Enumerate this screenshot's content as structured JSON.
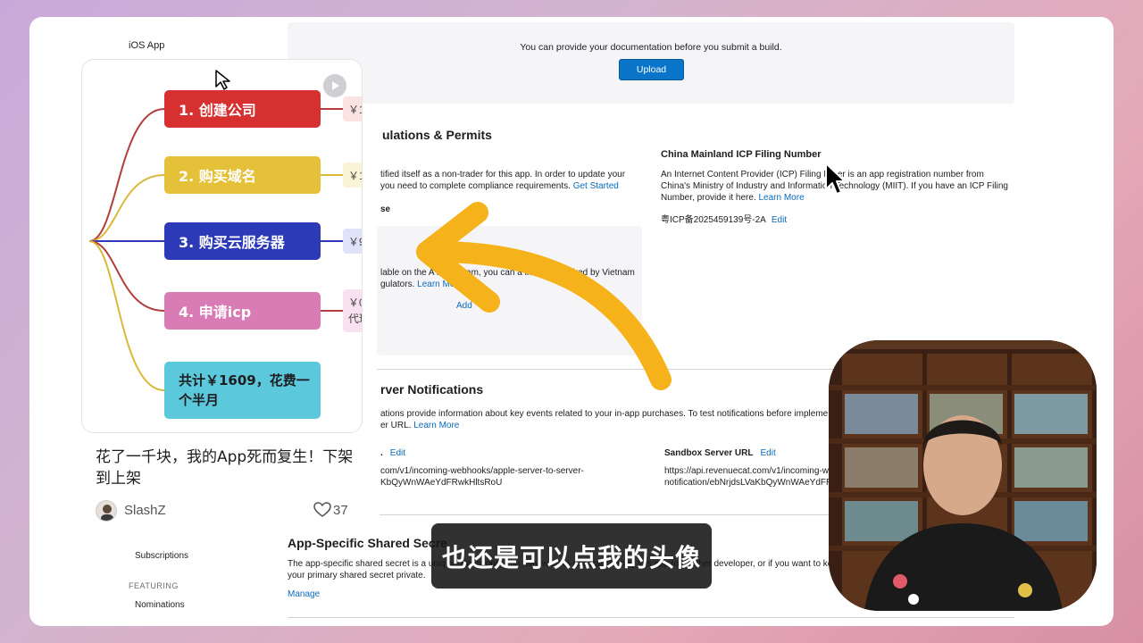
{
  "sidebar": {
    "app_label": "iOS App",
    "subscriptions": "Subscriptions",
    "featuring_header": "FEATURING",
    "nominations": "Nominations"
  },
  "documentation": {
    "text": "You can provide your documentation before you submit a build.",
    "upload_label": "Upload"
  },
  "regulations": {
    "heading": "ulations & Permits",
    "trader_text": "tified itself as a non-trader for this app. In order to update your you need to complete compliance requirements.",
    "trader_link": "Get Started",
    "section_label": "se",
    "vn_text": "lable on the A     in Vietnam, you can a         license required by Vietnam   gulators.",
    "vn_link": "Learn More",
    "vn_add": "Add"
  },
  "icp": {
    "title": "China Mainland ICP Filing Number",
    "description": "An Internet Content Provider (ICP) Filing N    ber is an app registration number from China's Ministry of Industry and Information Technology (MIIT). If you have an ICP Filing Number, provide it here.",
    "link": "Learn More",
    "value": "粤ICP备2025459139号-2A",
    "edit": "Edit"
  },
  "server_notifications": {
    "heading": "rver Notifications",
    "description": "ations provide information about key events related to your in-app purchases. To test notifications before impleme",
    "description2": "er URL.",
    "link": "Learn More",
    "production_label": ".",
    "production_edit": "Edit",
    "production_url": "com/v1/incoming-webhooks/apple-server-to-server-KbQyWnWAeYdFRwkHltsRoU",
    "sandbox_label": "Sandbox Server URL",
    "sandbox_edit": "Edit",
    "sandbox_url_1": "https://api.revenuecat.com/v1/incoming-w",
    "sandbox_url_2": "notification/ebNrjdsLVaKbQyWnWAeYdFR"
  },
  "shared_secret": {
    "heading": "App-Specific Shared Secre",
    "description": "The app-specific shared secret is a uniq                                                  subscriptions. You may want to use transferring this app to another developer, or if you want to keep your primary shared secret private.",
    "manage": "Manage"
  },
  "note_card": {
    "nodes": [
      {
        "label": "1. 创建公司",
        "color": "#d63031",
        "price": "￥1",
        "price_bg": "#fde2e2"
      },
      {
        "label": "2. 购买域名",
        "color": "#e5c13a",
        "price": "￥1",
        "price_bg": "#fbf3d5"
      },
      {
        "label": "3. 购买云服务器",
        "color": "#2d3ab8",
        "price": "￥9",
        "price_bg": "#dfe2f8"
      },
      {
        "label": "4. 申请icp",
        "color": "#d97bb4",
        "price": "￥0 代理",
        "price_bg": "#f8e2ef"
      },
      {
        "label": "共计￥1609，花费一个半月",
        "color": "#5bc8dc",
        "price": "",
        "price_bg": "#ffffff"
      }
    ],
    "title": "花了一千块，我的App死而复生！下架到上架",
    "author": "SlashZ",
    "likes": "37"
  },
  "subtitle": "也还是可以点我的头像"
}
